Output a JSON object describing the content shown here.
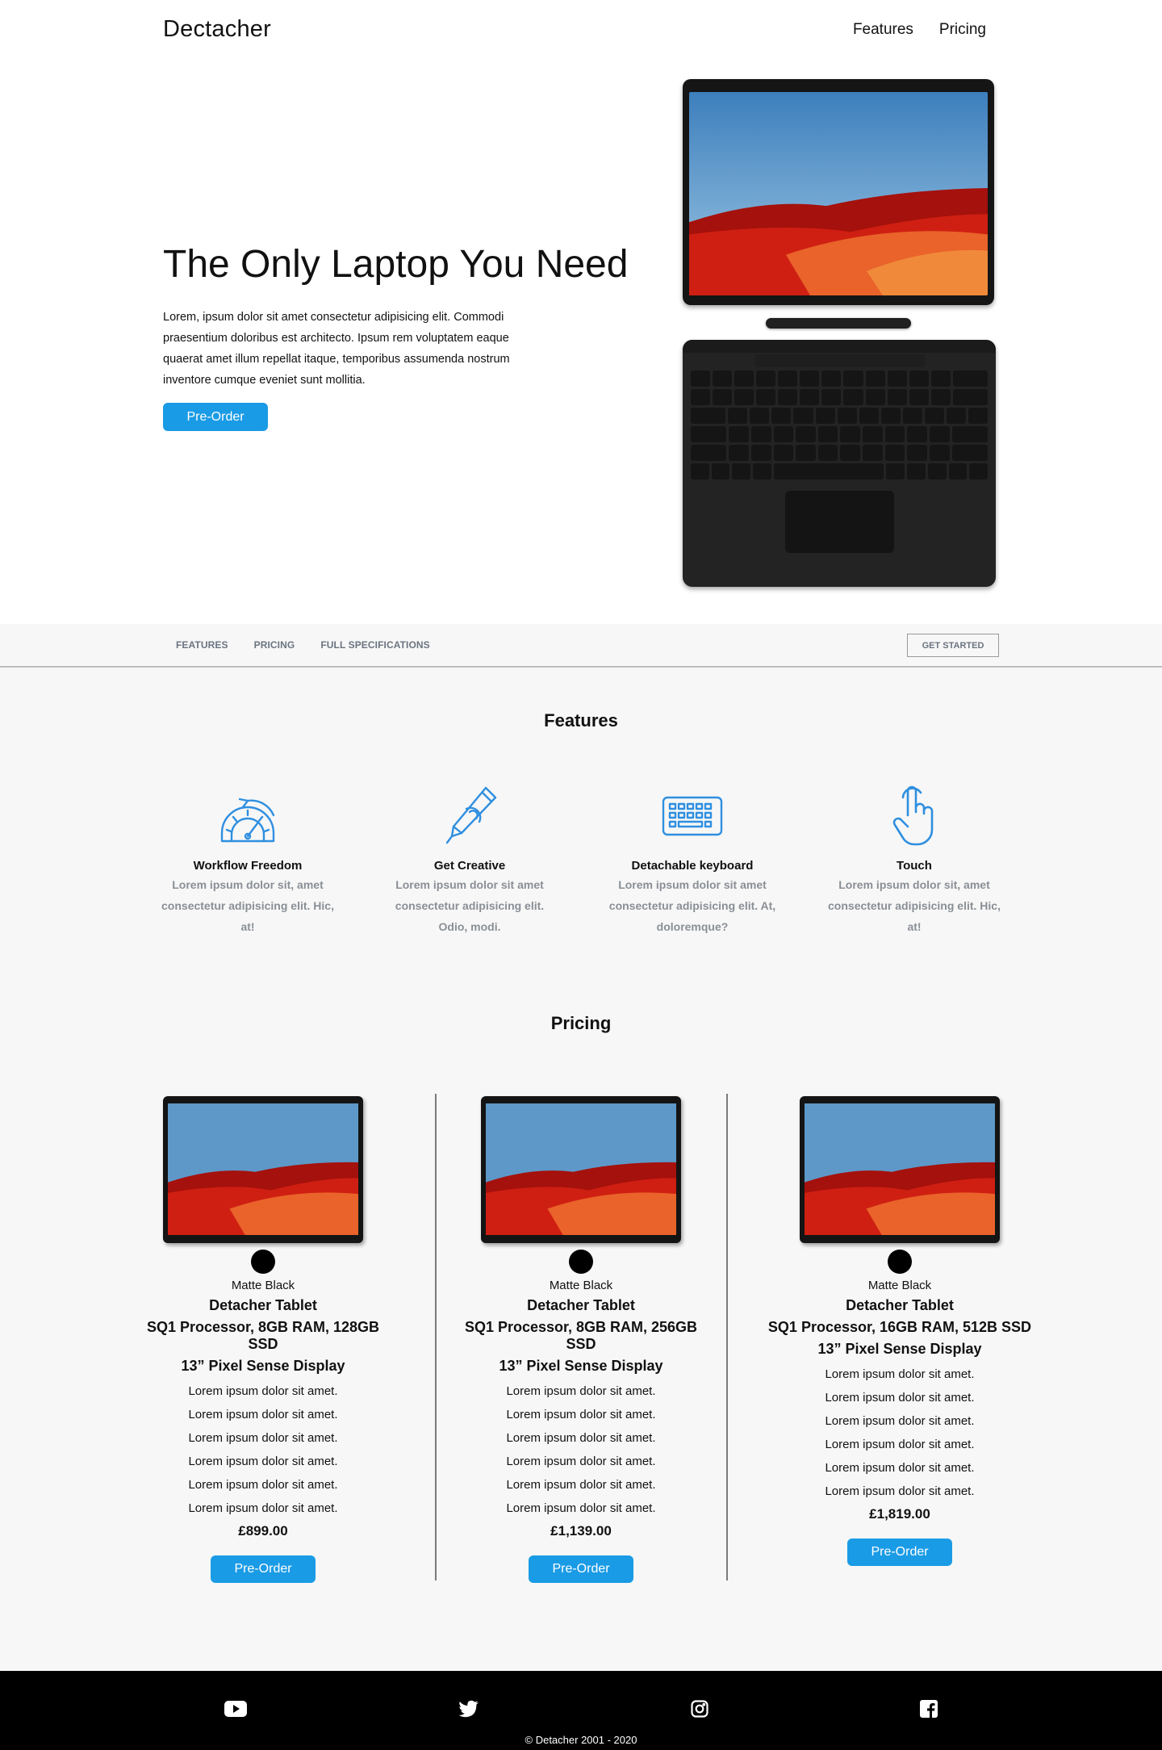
{
  "header": {
    "brand": "Dectacher",
    "nav": [
      {
        "label": "Features"
      },
      {
        "label": "Pricing"
      }
    ]
  },
  "hero": {
    "title": "The Only Laptop You Need",
    "text": "Lorem, ipsum dolor sit amet consectetur adipisicing elit. Commodi praesentium doloribus est architecto. Ipsum rem voluptatem eaque quaerat amet illum repellat itaque, temporibus assumenda nostrum inventore cumque eveniet sunt mollitia.",
    "button": "Pre-Order"
  },
  "subnav": {
    "links": [
      {
        "label": "FEATURES"
      },
      {
        "label": "PRICING"
      },
      {
        "label": "FULL SPECIFICATIONS"
      }
    ],
    "cta": "GET STARTED"
  },
  "features": {
    "title": "Features",
    "items": [
      {
        "icon": "speedometer-icon",
        "title": "Workflow Freedom",
        "text": "Lorem ipsum dolor sit, amet consectetur adipisicing elit. Hic, at!"
      },
      {
        "icon": "pen-icon",
        "title": "Get Creative",
        "text": "Lorem ipsum dolor sit amet consectetur adipisicing elit. Odio, modi."
      },
      {
        "icon": "keyboard-icon",
        "title": "Detachable keyboard",
        "text": "Lorem ipsum dolor sit amet consectetur adipisicing elit. At, doloremque?"
      },
      {
        "icon": "touch-icon",
        "title": "Touch",
        "text": "Lorem ipsum dolor sit, amet consectetur adipisicing elit. Hic, at!"
      }
    ]
  },
  "pricing": {
    "title": "Pricing",
    "plans": [
      {
        "color_name": "Matte Black",
        "name": "Detacher Tablet",
        "spec": "SQ1 Processor, 8GB RAM, 128GB SSD",
        "display": "13” Pixel Sense Display",
        "features": [
          "Lorem ipsum dolor sit amet.",
          "Lorem ipsum dolor sit amet.",
          "Lorem ipsum dolor sit amet.",
          "Lorem ipsum dolor sit amet.",
          "Lorem ipsum dolor sit amet.",
          "Lorem ipsum dolor sit amet."
        ],
        "price": "£899.00",
        "button": "Pre-Order"
      },
      {
        "color_name": "Matte Black",
        "name": "Detacher Tablet",
        "spec": "SQ1 Processor, 8GB RAM, 256GB SSD",
        "display": "13” Pixel Sense Display",
        "features": [
          "Lorem ipsum dolor sit amet.",
          "Lorem ipsum dolor sit amet.",
          "Lorem ipsum dolor sit amet.",
          "Lorem ipsum dolor sit amet.",
          "Lorem ipsum dolor sit amet.",
          "Lorem ipsum dolor sit amet."
        ],
        "price": "£1,139.00",
        "button": "Pre-Order"
      },
      {
        "color_name": "Matte Black",
        "name": "Detacher Tablet",
        "spec": "SQ1 Processor, 16GB RAM, 512B SSD",
        "display": "13” Pixel Sense Display",
        "features": [
          "Lorem ipsum dolor sit amet.",
          "Lorem ipsum dolor sit amet.",
          "Lorem ipsum dolor sit amet.",
          "Lorem ipsum dolor sit amet.",
          "Lorem ipsum dolor sit amet.",
          "Lorem ipsum dolor sit amet."
        ],
        "price": "£1,819.00",
        "button": "Pre-Order"
      }
    ]
  },
  "footer": {
    "social": [
      {
        "icon": "youtube-icon"
      },
      {
        "icon": "twitter-icon"
      },
      {
        "icon": "instagram-icon"
      },
      {
        "icon": "facebook-icon"
      }
    ],
    "copyright": "© Detacher 2001 - 2020"
  },
  "colors": {
    "accent": "#1a9be6",
    "icon_blue": "#2f8fe0",
    "footer_bg": "#000000",
    "section_bg": "#f7f7f7",
    "muted_text": "#8a8f96"
  }
}
